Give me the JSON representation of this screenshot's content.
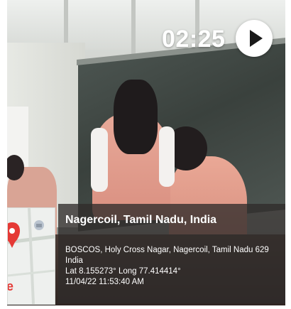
{
  "video": {
    "timer": "02:25",
    "play_icon": "play-icon"
  },
  "geotag": {
    "title": "Nagercoil, Tamil Nadu, India",
    "address": "BOSCOS, Holy Cross Nagar, Nagercoil, Tamil Nadu 629",
    "country": "India",
    "coordinates": "Lat 8.155273° Long 77.414414°",
    "datetime": "11/04/22 11:53:40 AM",
    "map_letter": "e",
    "map_icon": "map-pin-icon"
  },
  "colors": {
    "overlay": "#302c2a",
    "pin": "#e53935"
  }
}
